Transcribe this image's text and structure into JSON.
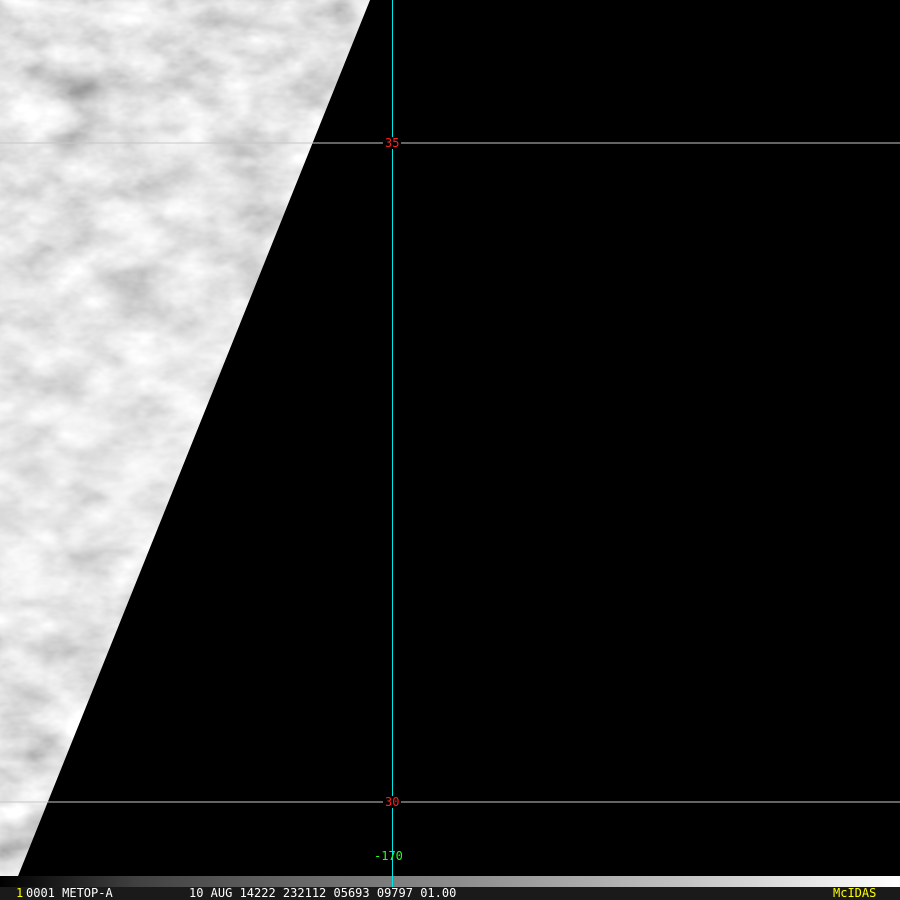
{
  "grid": {
    "lat_labels": [
      "35",
      "30"
    ],
    "lon_label": "-170",
    "colors": {
      "lat_line": "#c8c8c8",
      "lon_line": "#00e5e5",
      "lat_text": "#ff2020",
      "lon_text": "#20ff20"
    }
  },
  "status_bar": {
    "frame_number": "1",
    "satellite": "0001 METOP-A",
    "info": "10 AUG 14222 232112 05693 09797 01.00",
    "brand": "McIDAS",
    "colors": {
      "frame": "#ffff00",
      "brand": "#ffff00",
      "text": "#ffffff"
    }
  }
}
